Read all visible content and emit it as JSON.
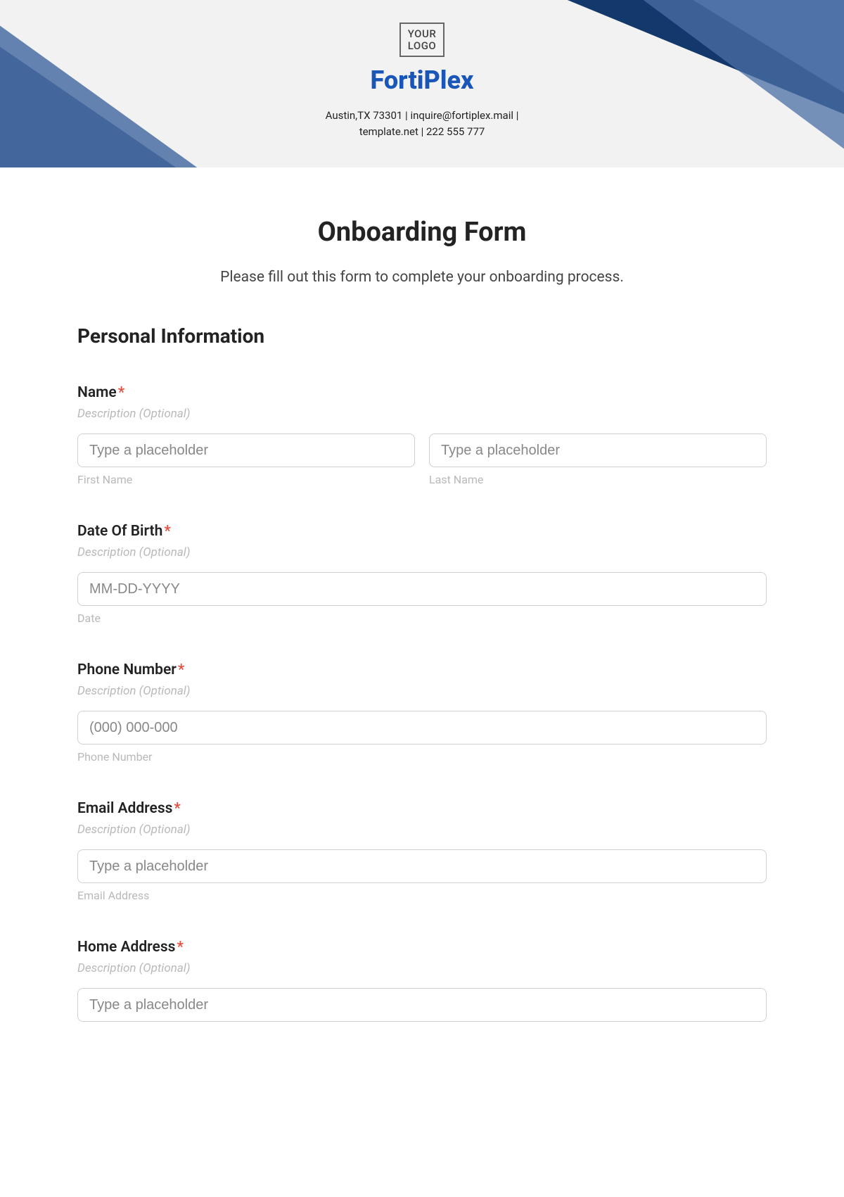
{
  "header": {
    "logo_text": "YOUR\nLOGO",
    "company": "FortiPlex",
    "contact_line1": "Austin,TX 73301 | inquire@fortiplex.mail |",
    "contact_line2": "template.net | 222 555 777"
  },
  "form": {
    "title": "Onboarding Form",
    "subtitle": "Please fill out this form to complete your onboarding process.",
    "section1": "Personal Information",
    "desc_optional": "Description (Optional)",
    "name": {
      "label": "Name",
      "first_placeholder": "Type a placeholder",
      "first_sub": "First Name",
      "last_placeholder": "Type a placeholder",
      "last_sub": "Last Name"
    },
    "dob": {
      "label": "Date Of Birth",
      "placeholder": "MM-DD-YYYY",
      "sub": "Date"
    },
    "phone": {
      "label": "Phone Number",
      "placeholder": "(000) 000-000",
      "sub": "Phone Number"
    },
    "email": {
      "label": "Email Address",
      "placeholder": "Type a placeholder",
      "sub": "Email Address"
    },
    "address": {
      "label": "Home Address",
      "placeholder": "Type a placeholder"
    }
  }
}
